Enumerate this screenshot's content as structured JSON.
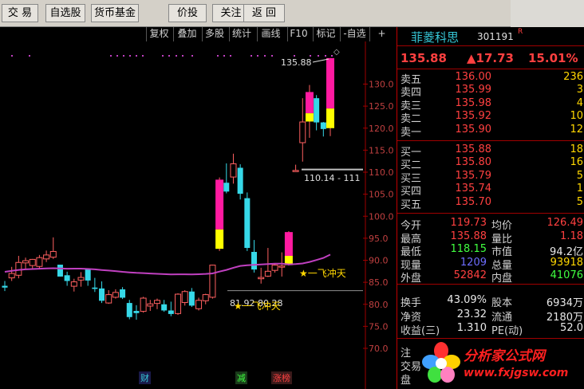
{
  "toolbar": {
    "items": [
      "交 易",
      "自选股",
      "货币基金",
      "价投",
      "关注",
      "返 回"
    ]
  },
  "subtoolbar": {
    "items": [
      "复权",
      "叠加",
      "多股",
      "统计",
      "画线",
      "F10",
      "标记",
      "-自选",
      "+"
    ]
  },
  "chart": {
    "y_ticks": [
      "130.0",
      "125.0",
      "120.0",
      "115.0",
      "110.0",
      "105.0",
      "100.0",
      "95.0",
      "90.0",
      "85.0",
      "80.0",
      "75.0",
      "70.0"
    ],
    "high_label": "135.88",
    "level_label": "110.14 - 111",
    "annotation_1": "★一飞冲天",
    "annotation_2": "81.92 80.28",
    "annotation_2_star": "★一飞冲天",
    "bottom_tags": [
      "财",
      "减",
      "涨榜"
    ],
    "colors": {
      "up": "#ff4fa0",
      "down": "#36d8e8",
      "ma": "#c040c0",
      "limit_up": "#ff1aa0",
      "limit_base": "#ffff00"
    }
  },
  "chart_data": {
    "type": "candlestick",
    "ylim": [
      70,
      138
    ],
    "candles": [
      {
        "o": 84.2,
        "h": 85.3,
        "l": 83.0,
        "c": 83.8
      },
      {
        "o": 86.0,
        "h": 88.5,
        "l": 85.3,
        "c": 87.0
      },
      {
        "o": 86.6,
        "h": 91.0,
        "l": 85.9,
        "c": 89.5
      },
      {
        "o": 89.4,
        "h": 90.6,
        "l": 87.9,
        "c": 89.9
      },
      {
        "o": 88.8,
        "h": 90.3,
        "l": 88.2,
        "c": 90.2
      },
      {
        "o": 88.6,
        "h": 91.2,
        "l": 88.1,
        "c": 90.6
      },
      {
        "o": 90.3,
        "h": 92.2,
        "l": 89.6,
        "c": 91.2
      },
      {
        "o": 90.7,
        "h": 95.2,
        "l": 90.3,
        "c": 92.0
      },
      {
        "o": 89.0,
        "h": 89.0,
        "l": 86.3,
        "c": 86.3
      },
      {
        "o": 86.6,
        "h": 87.4,
        "l": 84.2,
        "c": 85.3
      },
      {
        "o": 84.1,
        "h": 85.8,
        "l": 82.9,
        "c": 85.1
      },
      {
        "o": 85.5,
        "h": 87.3,
        "l": 84.0,
        "c": 86.1
      },
      {
        "o": 88.0,
        "h": 88.0,
        "l": 84.2,
        "c": 85.4
      },
      {
        "o": 83.8,
        "h": 86.0,
        "l": 82.8,
        "c": 83.5
      },
      {
        "o": 83.6,
        "h": 85.2,
        "l": 80.3,
        "c": 80.8
      },
      {
        "o": 80.3,
        "h": 83.2,
        "l": 80.1,
        "c": 82.2
      },
      {
        "o": 81.6,
        "h": 83.4,
        "l": 81.3,
        "c": 82.7
      },
      {
        "o": 83.4,
        "h": 83.9,
        "l": 81.2,
        "c": 81.5
      },
      {
        "o": 80.3,
        "h": 81.0,
        "l": 76.6,
        "c": 77.1
      },
      {
        "o": 78.5,
        "h": 79.8,
        "l": 76.5,
        "c": 78.0
      },
      {
        "o": 78.4,
        "h": 81.7,
        "l": 78.1,
        "c": 81.4
      },
      {
        "o": 79.6,
        "h": 81.0,
        "l": 78.5,
        "c": 80.1
      },
      {
        "o": 80.2,
        "h": 81.3,
        "l": 78.9,
        "c": 80.9
      },
      {
        "o": 80.0,
        "h": 81.0,
        "l": 78.3,
        "c": 78.6
      },
      {
        "o": 78.6,
        "h": 80.6,
        "l": 77.3,
        "c": 77.8
      },
      {
        "o": 77.9,
        "h": 82.5,
        "l": 77.6,
        "c": 82.3
      },
      {
        "o": 80.4,
        "h": 83.2,
        "l": 79.7,
        "c": 82.9
      },
      {
        "o": 82.9,
        "h": 83.7,
        "l": 79.4,
        "c": 79.7
      },
      {
        "o": 79.0,
        "h": 81.5,
        "l": 78.6,
        "c": 80.9
      },
      {
        "o": 80.8,
        "h": 82.4,
        "l": 80.0,
        "c": 82.2
      },
      {
        "o": 81.6,
        "h": 89.0,
        "l": 81.3,
        "c": 88.9
      },
      {
        "o": 92.6,
        "h": 108.8,
        "l": 92.1,
        "c": 108.3
      },
      {
        "o": 107.6,
        "h": 112.0,
        "l": 105.2,
        "c": 105.6
      },
      {
        "o": 108.9,
        "h": 114.2,
        "l": 107.4,
        "c": 111.9
      },
      {
        "o": 111.0,
        "h": 111.8,
        "l": 103.8,
        "c": 105.1
      },
      {
        "o": 104.1,
        "h": 105.4,
        "l": 92.1,
        "c": 92.8
      },
      {
        "o": 91.9,
        "h": 94.6,
        "l": 87.2,
        "c": 87.9
      },
      {
        "o": 85.8,
        "h": 88.3,
        "l": 84.7,
        "c": 86.1
      },
      {
        "o": 86.4,
        "h": 92.8,
        "l": 86.2,
        "c": 87.5
      },
      {
        "o": 87.7,
        "h": 89.1,
        "l": 87.2,
        "c": 88.9
      },
      {
        "o": 88.6,
        "h": 91.8,
        "l": 86.3,
        "c": 88.7
      },
      {
        "o": 88.9,
        "h": 96.6,
        "l": 88.8,
        "c": 96.4
      },
      {
        "o": 110.4,
        "h": 111.7,
        "l": 110.4,
        "c": 110.4
      },
      {
        "o": 116.7,
        "h": 126.8,
        "l": 112.4,
        "c": 121.4
      },
      {
        "o": 121.5,
        "h": 129.8,
        "l": 117.8,
        "c": 128.2
      },
      {
        "o": 126.8,
        "h": 127.5,
        "l": 119.5,
        "c": 121.3
      },
      {
        "o": 121.3,
        "h": 121.4,
        "l": 118.1,
        "c": 119.8
      },
      {
        "o": 120.0,
        "h": 135.9,
        "l": 118.2,
        "c": 135.9
      }
    ]
  },
  "panel": {
    "stock_name": "菲菱科思",
    "stock_code": "301191",
    "flag": "R",
    "price": "135.88",
    "change": "▲17.73",
    "change_pct": "15.01%",
    "sell": [
      {
        "label": "卖五",
        "price": "136.00",
        "vol": "236"
      },
      {
        "label": "卖四",
        "price": "135.99",
        "vol": "3"
      },
      {
        "label": "卖三",
        "price": "135.98",
        "vol": "4"
      },
      {
        "label": "卖二",
        "price": "135.92",
        "vol": "10"
      },
      {
        "label": "卖一",
        "price": "135.90",
        "vol": "12"
      }
    ],
    "buy": [
      {
        "label": "买一",
        "price": "135.88",
        "vol": "18"
      },
      {
        "label": "买二",
        "price": "135.80",
        "vol": "16"
      },
      {
        "label": "买三",
        "price": "135.79",
        "vol": "5"
      },
      {
        "label": "买四",
        "price": "135.74",
        "vol": "1"
      },
      {
        "label": "买五",
        "price": "135.70",
        "vol": "5"
      }
    ],
    "stats": [
      {
        "l1": "今开",
        "v1": "119.73",
        "l2": "均价",
        "v2": "126.49"
      },
      {
        "l1": "最高",
        "v1": "135.88",
        "l2": "量比",
        "v2": "1.18"
      },
      {
        "l1": "最低",
        "v1": "118.15",
        "l2": "市值",
        "v2": "94.2亿"
      },
      {
        "l1": "现量",
        "v1": "1209",
        "l2": "总量",
        "v2": "93918"
      },
      {
        "l1": "外盘",
        "v1": "52842",
        "l2": "内盘",
        "v2": "41076"
      }
    ],
    "stats2": [
      {
        "l1": "换手",
        "v1": "43.09%",
        "l2": "股本",
        "v2": "6934万"
      },
      {
        "l1": "净资",
        "v1": "23.32",
        "l2": "流通",
        "v2": "2180万"
      },
      {
        "l1": "收益(三)",
        "v1": "1.310",
        "l2": "PE(动)",
        "v2": "52.0"
      }
    ],
    "tail": [
      "注",
      "交易",
      "盘"
    ]
  },
  "logo": {
    "brand": "分析家公式网",
    "url": "www.fxjgsw.com"
  }
}
